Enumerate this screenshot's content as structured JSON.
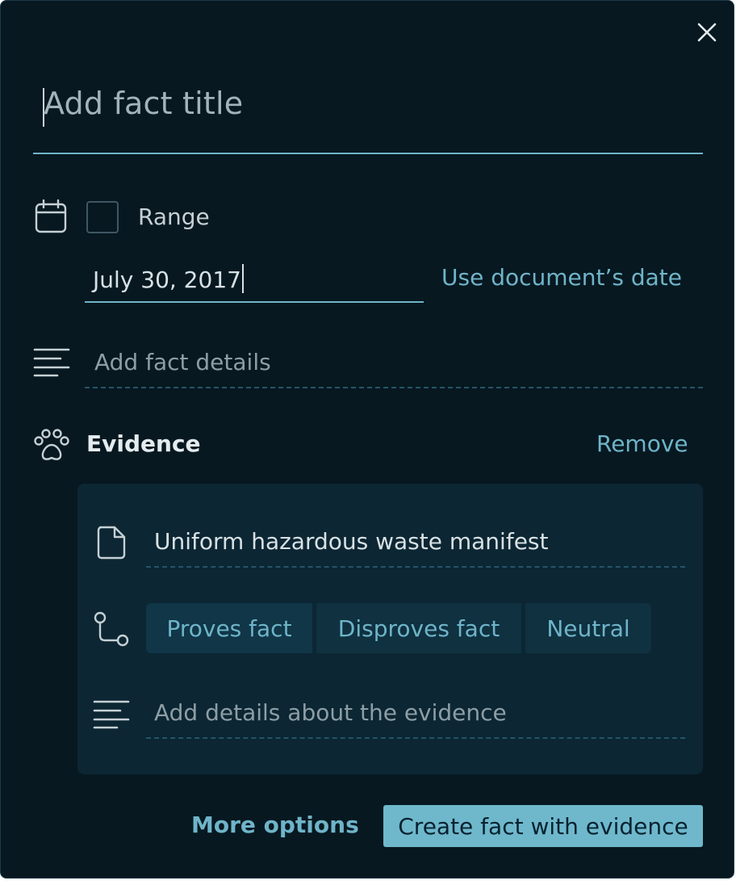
{
  "dialog": {
    "title_placeholder": "Add fact title",
    "range_label": "Range",
    "date_value": "July 30, 2017",
    "use_document_date_label": "Use document’s date",
    "details_placeholder": "Add fact details",
    "evidence": {
      "section_label": "Evidence",
      "remove_label": "Remove",
      "document_name": "Uniform hazardous waste manifest",
      "relation_options": [
        {
          "label": "Proves fact",
          "selected": true
        },
        {
          "label": "Disproves fact",
          "selected": false
        },
        {
          "label": "Neutral",
          "selected": false
        }
      ],
      "details_placeholder": "Add details about the evidence"
    },
    "more_options_label": "More options",
    "submit_label": "Create fact with evidence",
    "range_checked": false
  },
  "icons": {
    "close": "close-icon",
    "calendar": "calendar-icon",
    "details": "text-lines-icon",
    "evidence": "paw-icon",
    "document": "document-icon",
    "relation": "route-icon",
    "evidence_details": "text-lines-icon"
  },
  "colors": {
    "panel_background": "#071820",
    "evidence_box_background": "#0c2633",
    "accent": "#6fb4c9",
    "primary_button": "#6fb8cc",
    "text_primary": "#d8e1e4",
    "text_placeholder": "#8d9ea5"
  }
}
